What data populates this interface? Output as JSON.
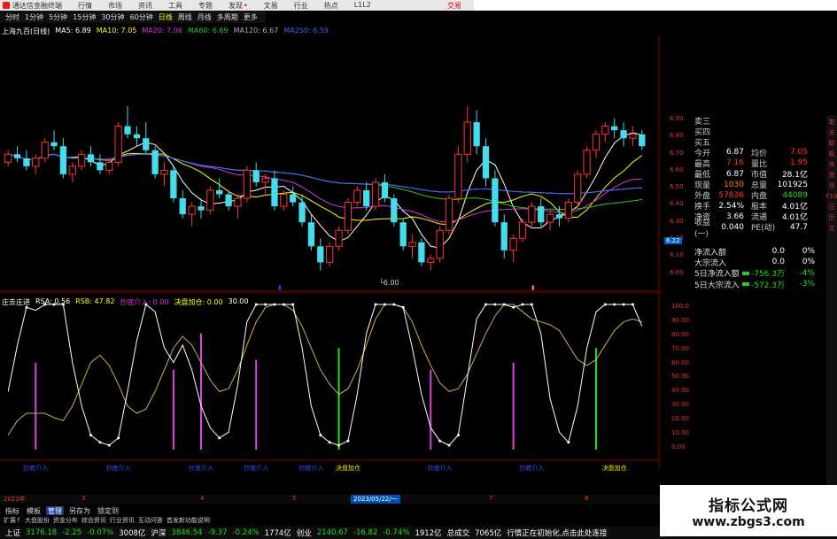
{
  "titlebar": {
    "app_name": "通达信金融终端",
    "menu": [
      "行情",
      "市场",
      "资讯",
      "工具",
      "专题",
      "发现",
      "文易",
      "行业",
      "热点",
      "L1L2"
    ],
    "right_label": "交易"
  },
  "periods": {
    "items": [
      "分时",
      "1分钟",
      "5分钟",
      "15分钟",
      "30分钟",
      "60分钟",
      "日线",
      "周线",
      "月线",
      "多周期",
      "更多"
    ],
    "active": "日线"
  },
  "main_header": {
    "title": "上海九百(日线)",
    "ma": [
      {
        "label": "MA5: 6.89",
        "color": "#ffffff"
      },
      {
        "label": "MA10: 7.05",
        "color": "#ffff00"
      },
      {
        "label": "MA20: 7.06",
        "color": "#dd33dd"
      },
      {
        "label": "MA60: 6.69",
        "color": "#22cc22"
      },
      {
        "label": "MA120: 6.67",
        "color": "#aaaaaa"
      },
      {
        "label": "MA250: 6.59",
        "color": "#3366ff"
      }
    ]
  },
  "chart_data": {
    "type": "candlestick",
    "low_marker": "6.00",
    "date_marker": "2023/05/22/一",
    "candles": [
      [
        7.4,
        7.55,
        7.35,
        7.5
      ],
      [
        7.5,
        7.6,
        7.4,
        7.45
      ],
      [
        7.45,
        7.55,
        7.3,
        7.35
      ],
      [
        7.35,
        7.5,
        7.25,
        7.45
      ],
      [
        7.45,
        7.7,
        7.4,
        7.65
      ],
      [
        7.65,
        7.8,
        7.55,
        7.6
      ],
      [
        7.6,
        7.7,
        7.2,
        7.25
      ],
      [
        7.25,
        7.4,
        7.15,
        7.35
      ],
      [
        7.35,
        7.55,
        7.3,
        7.5
      ],
      [
        7.5,
        7.6,
        7.35,
        7.4
      ],
      [
        7.4,
        7.5,
        7.25,
        7.3
      ],
      [
        7.3,
        7.45,
        7.25,
        7.4
      ],
      [
        7.4,
        7.9,
        7.35,
        7.85
      ],
      [
        7.85,
        8.1,
        7.7,
        7.75
      ],
      [
        7.75,
        7.85,
        7.6,
        7.7
      ],
      [
        7.7,
        7.9,
        7.5,
        7.55
      ],
      [
        7.55,
        7.6,
        7.2,
        7.25
      ],
      [
        7.25,
        7.4,
        7.1,
        7.3
      ],
      [
        7.3,
        7.35,
        6.9,
        6.95
      ],
      [
        6.95,
        7.05,
        6.7,
        6.75
      ],
      [
        6.75,
        6.9,
        6.6,
        6.85
      ],
      [
        6.85,
        6.95,
        6.7,
        6.8
      ],
      [
        6.8,
        7.1,
        6.75,
        7.05
      ],
      [
        7.05,
        7.2,
        6.95,
        7.0
      ],
      [
        7.0,
        7.05,
        6.8,
        6.85
      ],
      [
        6.85,
        7.0,
        6.7,
        6.95
      ],
      [
        6.95,
        7.35,
        6.9,
        7.3
      ],
      [
        7.3,
        7.4,
        7.1,
        7.15
      ],
      [
        7.15,
        7.25,
        7.0,
        7.2
      ],
      [
        7.2,
        7.3,
        6.8,
        6.85
      ],
      [
        6.85,
        7.05,
        6.8,
        7.0
      ],
      [
        7.0,
        7.1,
        6.85,
        6.9
      ],
      [
        6.9,
        7.0,
        6.6,
        6.65
      ],
      [
        6.65,
        6.75,
        6.3,
        6.35
      ],
      [
        6.35,
        6.45,
        6.05,
        6.15
      ],
      [
        6.15,
        6.4,
        6.1,
        6.35
      ],
      [
        6.35,
        6.6,
        6.3,
        6.55
      ],
      [
        6.55,
        6.95,
        6.5,
        6.9
      ],
      [
        6.9,
        7.1,
        6.85,
        7.05
      ],
      [
        7.05,
        7.15,
        6.8,
        6.85
      ],
      [
        6.85,
        7.2,
        6.8,
        7.15
      ],
      [
        7.15,
        7.25,
        6.9,
        6.95
      ],
      [
        6.95,
        7.0,
        6.6,
        6.65
      ],
      [
        6.65,
        6.7,
        6.3,
        6.35
      ],
      [
        6.35,
        6.5,
        6.2,
        6.4
      ],
      [
        6.4,
        6.45,
        6.1,
        6.15
      ],
      [
        6.15,
        6.25,
        6.05,
        6.2
      ],
      [
        6.2,
        6.6,
        6.15,
        6.55
      ],
      [
        6.55,
        7.0,
        6.5,
        6.95
      ],
      [
        6.95,
        7.6,
        6.9,
        7.5
      ],
      [
        7.5,
        8.1,
        7.4,
        7.9
      ],
      [
        7.9,
        8.05,
        7.5,
        7.6
      ],
      [
        7.6,
        7.7,
        7.1,
        7.2
      ],
      [
        7.2,
        7.3,
        6.6,
        6.65
      ],
      [
        6.65,
        6.75,
        6.2,
        6.3
      ],
      [
        6.3,
        6.5,
        6.15,
        6.45
      ],
      [
        6.45,
        6.7,
        6.4,
        6.65
      ],
      [
        6.65,
        6.9,
        6.6,
        6.85
      ],
      [
        6.85,
        6.95,
        6.6,
        6.65
      ],
      [
        6.65,
        6.8,
        6.55,
        6.75
      ],
      [
        6.75,
        6.85,
        6.6,
        6.7
      ],
      [
        6.7,
        6.95,
        6.65,
        6.9
      ],
      [
        6.9,
        7.3,
        6.85,
        7.25
      ],
      [
        7.25,
        7.6,
        7.2,
        7.55
      ],
      [
        7.55,
        7.8,
        7.45,
        7.75
      ],
      [
        7.75,
        7.9,
        7.65,
        7.85
      ],
      [
        7.85,
        7.95,
        7.7,
        7.8
      ],
      [
        7.8,
        7.9,
        7.6,
        7.7
      ],
      [
        7.7,
        7.85,
        7.6,
        7.75
      ],
      [
        7.75,
        7.8,
        7.55,
        7.6
      ]
    ],
    "ind_labels": [
      "庄去庄进",
      "RSA: 0.56",
      "RSB: 47.82",
      "抄底介入: 0.00",
      "决盘加仓: 0.00",
      "30.00"
    ],
    "ind_ticks": [
      "100.0",
      "90.00",
      "80.00",
      "70.00",
      "60.00",
      "50.00",
      "40.00",
      "30.00",
      "20.00",
      "10.00",
      "0.00"
    ],
    "rsa": [
      40,
      72,
      98,
      96,
      100,
      100,
      100,
      60,
      30,
      10,
      5,
      3,
      8,
      40,
      75,
      100,
      95,
      70,
      60,
      72,
      55,
      30,
      15,
      8,
      12,
      45,
      88,
      100,
      100,
      100,
      100,
      100,
      70,
      30,
      10,
      5,
      3,
      6,
      38,
      80,
      100,
      100,
      100,
      98,
      70,
      38,
      15,
      6,
      3,
      10,
      50,
      90,
      100,
      100,
      100,
      98,
      100,
      100,
      80,
      35,
      12,
      5,
      30,
      70,
      95,
      100,
      100,
      100,
      100,
      85
    ],
    "rsb": [
      10,
      20,
      25,
      25,
      25,
      22,
      20,
      30,
      45,
      60,
      65,
      58,
      45,
      30,
      25,
      28,
      40,
      55,
      70,
      78,
      72,
      60,
      48,
      40,
      42,
      55,
      72,
      88,
      98,
      100,
      100,
      96,
      85,
      70,
      55,
      45,
      38,
      42,
      55,
      72,
      90,
      100,
      100,
      98,
      88,
      72,
      58,
      46,
      40,
      42,
      52,
      66,
      80,
      92,
      100,
      100,
      95,
      90,
      88,
      86,
      82,
      72,
      62,
      58,
      62,
      72,
      82,
      88,
      90,
      88
    ],
    "buy_bars": [
      {
        "i": 3,
        "h": 60,
        "color": "#dd44dd"
      },
      {
        "i": 18,
        "h": 55,
        "color": "#dd44dd"
      },
      {
        "i": 21,
        "h": 80,
        "color": "#dd44dd"
      },
      {
        "i": 27,
        "h": 62,
        "color": "#dd44dd"
      },
      {
        "i": 36,
        "h": 70,
        "color": "#22dd22"
      },
      {
        "i": 46,
        "h": 55,
        "color": "#dd44dd"
      },
      {
        "i": 55,
        "h": 60,
        "color": "#dd44dd"
      },
      {
        "i": 64,
        "h": 70,
        "color": "#22dd22"
      }
    ],
    "signals": [
      {
        "i": 3,
        "text": "抄底介入",
        "color": "#3355ff"
      },
      {
        "i": 12,
        "text": "抄底介入",
        "color": "#3355ff"
      },
      {
        "i": 21,
        "text": "抄底介入",
        "color": "#3355ff"
      },
      {
        "i": 27,
        "text": "抄底介入",
        "color": "#3355ff"
      },
      {
        "i": 33,
        "text": "抄底介入",
        "color": "#3355ff"
      },
      {
        "i": 37,
        "text": "决盘加仓",
        "color": "#ffee00"
      },
      {
        "i": 47,
        "text": "抄底介入",
        "color": "#3355ff"
      },
      {
        "i": 57,
        "text": "抄底介入",
        "color": "#3355ff"
      },
      {
        "i": 66,
        "text": "决盘加仓",
        "color": "#ffee00"
      }
    ]
  },
  "price_axis": [
    "6.90",
    "6.80",
    "6.70",
    "6.60",
    "6.50",
    "6.40",
    "6.30",
    "6.20",
    "6.10",
    "6.00"
  ],
  "price_current": "6.22",
  "quote": {
    "asks": [
      {
        "l": "卖三"
      },
      {
        "l": "买四"
      },
      {
        "l": "买五"
      }
    ],
    "rows": [
      {
        "l": "今开",
        "v": "6.87",
        "l2": "均价",
        "v2": "7.05",
        "c": "wht",
        "c2": "red"
      },
      {
        "l": "最高",
        "v": "7.16",
        "l2": "量比",
        "v2": "1.95",
        "c": "red",
        "c2": "red"
      },
      {
        "l": "最低",
        "v": "6.87",
        "l2": "市值",
        "v2": "28.1亿",
        "c": "wht",
        "c2": "wht"
      },
      {
        "l": "现量",
        "v": "1030",
        "l2": "总量",
        "v2": "101925",
        "c": "orn",
        "c2": "wht"
      },
      {
        "l": "外盘",
        "v": "57836",
        "l2": "内盘",
        "v2": "44089",
        "c": "red",
        "c2": "grn"
      },
      {
        "l": "换手",
        "v": "2.54%",
        "l2": "股本",
        "v2": "4.01亿",
        "c": "wht",
        "c2": "wht"
      },
      {
        "l": "净资",
        "v": "3.66",
        "l2": "流通",
        "v2": "4.01亿",
        "c": "wht",
        "c2": "wht"
      },
      {
        "l": "收益(一)",
        "v": "0.040",
        "l2": "PE(动)",
        "v2": "47.7",
        "c": "wht",
        "c2": "wht"
      }
    ]
  },
  "flow": [
    {
      "l": "净流入额",
      "v": "0.0",
      "p": "0%",
      "c": "wht"
    },
    {
      "l": "大宗流入",
      "v": "0.0",
      "p": "0%",
      "c": "wht"
    },
    {
      "l": "5日净流入额",
      "v": "-756.3万",
      "p": "-4%",
      "c": "grn"
    },
    {
      "l": "5日大宗流入",
      "v": "-572.3万",
      "p": "-3%",
      "c": "grn"
    }
  ],
  "date_bar": {
    "year": "2023年",
    "months": [
      "3",
      "4",
      "5",
      "6",
      "7",
      "8"
    ],
    "selected": "2023/05/22/一"
  },
  "bottom_tabs1": {
    "items": [
      "指标",
      "模板",
      "管理",
      "另存为",
      "锁定到"
    ],
    "active": "管理"
  },
  "bottom_tabs2": [
    "扩展↑",
    "大盘股份",
    "资金分布",
    "综合资讯",
    "行业资讯",
    "互动问答",
    "首发新功能说明"
  ],
  "status": [
    {
      "t": "上证",
      "c": "wht"
    },
    {
      "t": "3176.18",
      "c": "grn"
    },
    {
      "t": "-2.25",
      "c": "grn"
    },
    {
      "t": "-0.07%",
      "c": "grn"
    },
    {
      "t": "3008亿",
      "c": "wht"
    },
    {
      "t": "沪深",
      "c": "wht"
    },
    {
      "t": "3846.54",
      "c": "grn"
    },
    {
      "t": "-9.37",
      "c": "grn"
    },
    {
      "t": "-0.24%",
      "c": "grn"
    },
    {
      "t": "1774亿",
      "c": "wht"
    },
    {
      "t": "创业",
      "c": "wht"
    },
    {
      "t": "2140.67",
      "c": "grn"
    },
    {
      "t": "-16.82",
      "c": "grn"
    },
    {
      "t": "-0.74%",
      "c": "grn"
    },
    {
      "t": "1912亿",
      "c": "wht"
    },
    {
      "t": "总成交",
      "c": "wht"
    },
    {
      "t": "7065亿",
      "c": "wht"
    },
    {
      "t": "行情正在初始化,点击此处连接",
      "c": "wht"
    }
  ],
  "right_tabs": [
    "笔",
    "关",
    "联",
    "板",
    "块",
    "资",
    "讯",
    "F10",
    "日",
    "历",
    "文"
  ],
  "watermark": {
    "line1": "指标公式网",
    "line2": "www.zbgs3.com"
  }
}
